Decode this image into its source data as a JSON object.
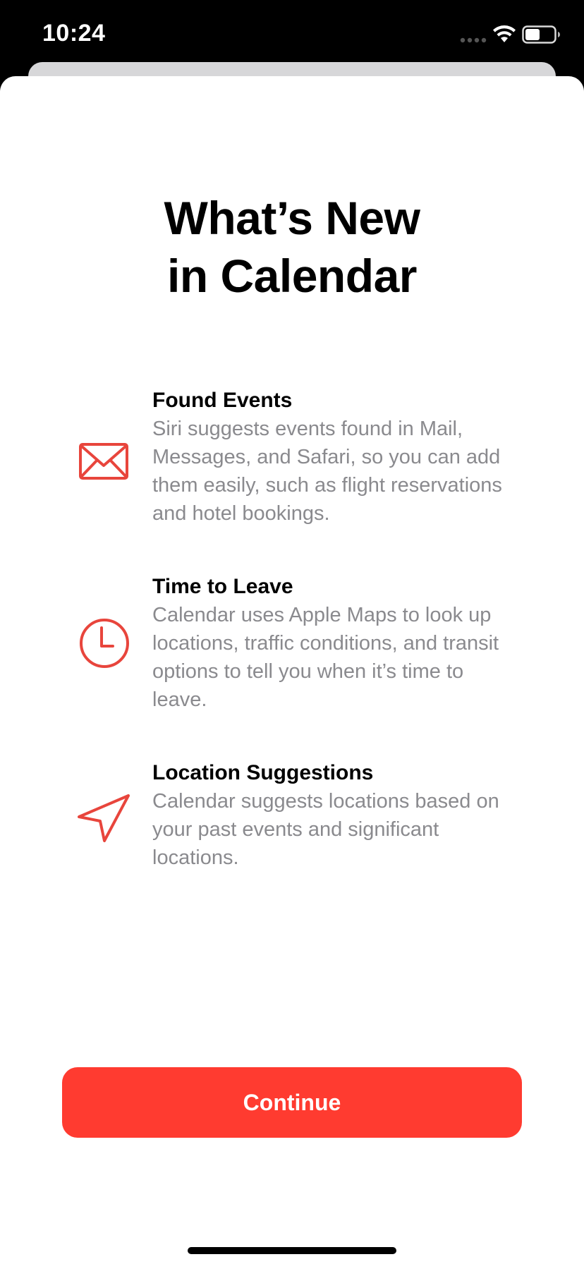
{
  "status_bar": {
    "time": "10:24",
    "icons": [
      "signal-icon",
      "wifi-icon",
      "battery-icon"
    ]
  },
  "sheet": {
    "title_line1": "What’s New",
    "title_line2": "in Calendar"
  },
  "features": [
    {
      "icon": "envelope-icon",
      "title": "Found Events",
      "description": "Siri suggests events found in Mail, Messages, and Safari, so you can add them easily, such as flight reservations and hotel bookings."
    },
    {
      "icon": "clock-icon",
      "title": "Time to Leave",
      "description": "Calendar uses Apple Maps to look up locations, traffic conditions, and transit options to tell you when it’s time to leave."
    },
    {
      "icon": "location-arrow-icon",
      "title": "Location Suggestions",
      "description": "Calendar suggests locations based on your past events and significant locations."
    }
  ],
  "continue_button": {
    "label": "Continue"
  },
  "colors": {
    "accent": "#ff3b30",
    "icon": "#e8453c",
    "secondary_text": "#8a8a8e",
    "sheet_background": "#ffffff"
  }
}
